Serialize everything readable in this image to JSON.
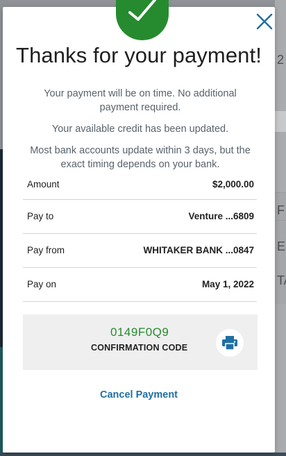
{
  "modal": {
    "title": "Thanks for your payment!",
    "messages": [
      "Your payment will be on time. No additional payment required.",
      "Your available credit has been updated.",
      "Most bank accounts update within 3 days, but the exact timing depends on your bank."
    ],
    "details": [
      {
        "label": "Amount",
        "value": "$2,000.00"
      },
      {
        "label": "Pay to",
        "value": "Venture ...6809"
      },
      {
        "label": "Pay from",
        "value": "WHITAKER BANK ...0847"
      },
      {
        "label": "Pay on",
        "value": "May 1, 2022"
      }
    ],
    "confirmation": {
      "code": "0149F0Q9",
      "label": "CONFIRMATION CODE"
    },
    "cancel_label": "Cancel Payment",
    "icons": {
      "success": "checkmark-icon",
      "close": "close-icon",
      "print": "printer-icon"
    }
  },
  "background": {
    "right_letters": [
      "2",
      "F",
      "E",
      "TA"
    ]
  },
  "colors": {
    "success_green": "#258b2e",
    "link_blue": "#1f6fa3",
    "close_blue": "#1f6fa3",
    "overlay": "#8f9296"
  }
}
